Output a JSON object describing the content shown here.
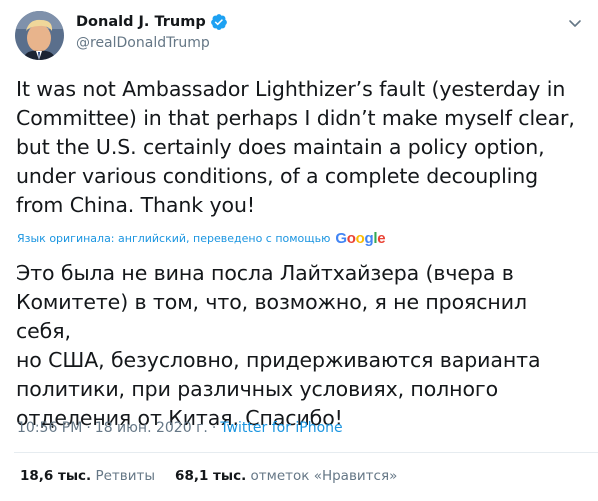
{
  "author": {
    "display_name": "Donald J. Trump",
    "handle": "@realDonaldTrump",
    "verified_icon": "verified-badge-icon",
    "avatar": "profile-avatar"
  },
  "menu_icon": "chevron-down-icon",
  "tweet": {
    "text": "It was not Ambassador Lighthizer’s fault (yesterday in\nCommittee) in that perhaps I didn’t make myself clear,\nbut the U.S. certainly does maintain a policy option,\nunder various conditions, of a complete decoupling\nfrom China. Thank you!"
  },
  "translation": {
    "note": "Язык оригинала: английский, переведено с помощью",
    "provider": "Google",
    "text": "Это была не вина посла Лайтхайзера (вчера в\nКомитете) в том, что, возможно, я не прояснил себя,\nно США, безусловно, придерживаются варианта\nполитики, при различных условиях, полного\nотделения от Китая. Спасибо!"
  },
  "meta": {
    "time": "10:56 PM",
    "separator": "·",
    "date": "18 июн. 2020 г.",
    "source": "Twitter for iPhone"
  },
  "stats": {
    "retweets_count": "18,6 тыс.",
    "retweets_label": "Ретвиты",
    "likes_count": "68,1 тыс.",
    "likes_label": "отметок «Нравится»"
  },
  "colors": {
    "text": "#14171a",
    "secondary": "#657786",
    "link": "#1b95e0",
    "verified": "#1da1f2",
    "divider": "#e6ecf0"
  }
}
